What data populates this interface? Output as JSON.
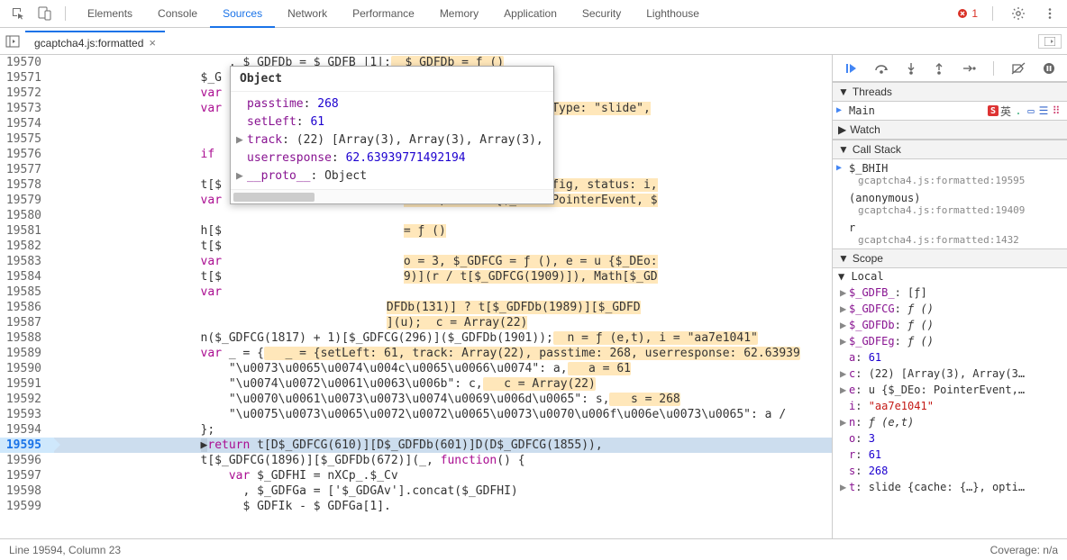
{
  "tabs": {
    "items": [
      "Elements",
      "Console",
      "Sources",
      "Network",
      "Performance",
      "Memory",
      "Application",
      "Security",
      "Lighthouse"
    ],
    "activeIndex": 2
  },
  "errors": 1,
  "file": {
    "name": "gcaptcha4.js:formatted"
  },
  "code": {
    "lines": [
      {
        "n": 19570,
        "pre": "                        , $ GDFDb = $ GDFB |1|;",
        "hl": "  $ GDFDb = ƒ ()"
      },
      {
        "n": 19571,
        "pre": "                    $_G"
      },
      {
        "n": 19572,
        "pre": "                    var"
      },
      {
        "n": 19573,
        "pre": "                    var",
        "post": "nfig, status: i, lastType: \"slide\","
      },
      {
        "n": 19574,
        "pre": "                       ",
        "post": "ƒ ()"
      },
      {
        "n": 19575,
        "pre": "",
        "post": "e1041\", $_GDFDb = ƒ ()"
      },
      {
        "n": 19576,
        "pre": "                    if "
      },
      {
        "n": 19577,
        "pre": ""
      },
      {
        "n": 19578,
        "pre": "                    t[$",
        "post": "he: {…}, options: Config, status: i,"
      },
      {
        "n": 19579,
        "pre": "                    var",
        "post": " = 61, e = u {$_DEo: PointerEvent, $"
      },
      {
        "n": 19580,
        "pre": ""
      },
      {
        "n": 19581,
        "pre": "                    h[$",
        "post": "= ƒ ()"
      },
      {
        "n": 19582,
        "pre": "                    t[$"
      },
      {
        "n": 19583,
        "pre": "                    var",
        "post": "o = 3, $_GDFCG = ƒ (), e = u {$_DEo:"
      },
      {
        "n": 19584,
        "pre": "                    t[$",
        "post": "9)](r / t[$_GDFCG(1909)]), Math[$_GD"
      },
      {
        "n": 19585,
        "pre": "                    var"
      },
      {
        "n": 19586,
        "pre": "",
        "post": "DFDb(131)] ? t[$_GDFDb(1989)][$_GDFD"
      },
      {
        "n": 19587,
        "pre": "",
        "post": "](u);  c = Array(22)"
      },
      {
        "n": 19588,
        "pre": "                    n($_GDFCG(1817) + 1)[$_GDFCG(296)]($_GDFDb(1901));",
        "hl": "  n = ƒ (e,t), i = \"aa7e1041\""
      },
      {
        "n": 19589,
        "pre": "                    var _ = {",
        "hl": "   _ = {setLeft: 61, track: Array(22), passtime: 268, userresponse: 62.63939"
      },
      {
        "n": 19590,
        "pre": "                        \"\\u0073\\u0065\\u0074\\u004c\\u0065\\u0066\\u0074\": a,",
        "hl": "   a = 61"
      },
      {
        "n": 19591,
        "pre": "                        \"\\u0074\\u0072\\u0061\\u0063\\u006b\": c,",
        "hl": "   c = Array(22)"
      },
      {
        "n": 19592,
        "pre": "                        \"\\u0070\\u0061\\u0073\\u0073\\u0074\\u0069\\u006d\\u0065\": s,",
        "hl": "   s = 268"
      },
      {
        "n": 19593,
        "pre": "                        \"\\u0075\\u0073\\u0065\\u0072\\u0072\\u0065\\u0073\\u0070\\u006f\\u006e\\u0073\\u0065\": a /"
      },
      {
        "n": 19594,
        "pre": "                    };"
      },
      {
        "n": 19595,
        "exec": true,
        "rich": "return"
      },
      {
        "n": 19596,
        "pre": "                    t[$_GDFCG(1896)][$_GDFDb(672)](_, function() {"
      },
      {
        "n": 19597,
        "pre": "                        var $_GDFHI = nXCp_.$_Cv"
      },
      {
        "n": 19598,
        "pre": "                          , $_GDFGa = ['$_GDGAv'].concat($_GDFHI)"
      },
      {
        "n": 19599,
        "pre": "                          $ GDFIk - $ GDFGa[1]."
      }
    ],
    "execLine": {
      "ret": "return",
      "body": " t[D$_GDFCG(610)][D$_GDFDb(601)]D(D$_GDFCG(1855)),"
    }
  },
  "popup": {
    "title": "Object",
    "rows": [
      {
        "k": "passtime",
        "v": "268",
        "num": true
      },
      {
        "k": "setLeft",
        "v": "61",
        "num": true
      },
      {
        "k": "track",
        "v": "(22) [Array(3), Array(3), Array(3),",
        "exp": true
      },
      {
        "k": "userresponse",
        "v": "62.63939771492194",
        "num": true
      },
      {
        "k": "__proto__",
        "v": "Object",
        "exp": true
      }
    ]
  },
  "status": {
    "left": "Line 19594, Column 23",
    "right": "Coverage: n/a"
  },
  "side": {
    "threads": {
      "title": "Threads",
      "main": "Main"
    },
    "watch": "Watch",
    "callstack": {
      "title": "Call Stack",
      "items": [
        {
          "name": "$_BHIH",
          "loc": "gcaptcha4.js:formatted:19595",
          "active": true
        },
        {
          "name": "(anonymous)",
          "loc": "gcaptcha4.js:formatted:19409"
        },
        {
          "name": "r",
          "loc": "gcaptcha4.js:formatted:1432"
        }
      ]
    },
    "scope": {
      "title": "Scope",
      "local": "Local",
      "items": [
        {
          "exp": true,
          "k": "$_GDFB_",
          "v": "[ƒ]"
        },
        {
          "exp": true,
          "k": "$_GDFCG",
          "v": "ƒ ()",
          "i": true
        },
        {
          "exp": true,
          "k": "$_GDFDb",
          "v": "ƒ ()",
          "i": true
        },
        {
          "exp": true,
          "k": "$_GDFEg",
          "v": "ƒ ()",
          "i": true
        },
        {
          "k": "a",
          "v": "61",
          "num": true
        },
        {
          "exp": true,
          "k": "c",
          "v": "(22) [Array(3), Array(3…"
        },
        {
          "exp": true,
          "k": "e",
          "v": "u {$_DEo: PointerEvent,…"
        },
        {
          "k": "i",
          "v": "\"aa7e1041\"",
          "str": true
        },
        {
          "exp": true,
          "k": "n",
          "v": "ƒ (e,t)",
          "i": true
        },
        {
          "k": "o",
          "v": "3",
          "num": true
        },
        {
          "k": "r",
          "v": "61",
          "num": true
        },
        {
          "k": "s",
          "v": "268",
          "num": true
        },
        {
          "exp": true,
          "k": "t",
          "v": "slide {cache: {…}, opti…"
        }
      ]
    }
  },
  "ime": {
    "label": "英"
  }
}
